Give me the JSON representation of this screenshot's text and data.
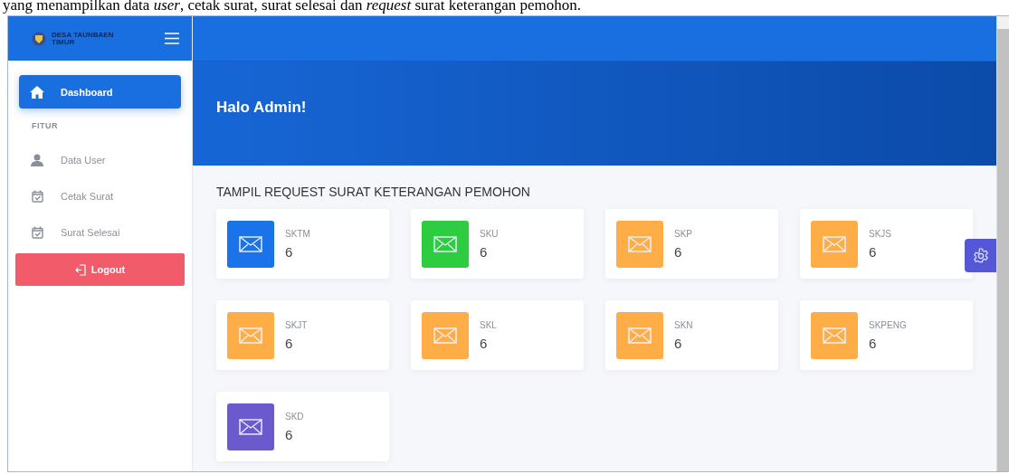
{
  "caption": "yang menampilkan data *user*, cetak surat, surat selesai dan *request* surat keterangan pemohon.",
  "brand": {
    "name": "DESA TAUNBAEN TIMUR"
  },
  "sidebar": {
    "items": [
      {
        "kind": "link",
        "label": "Dashboard",
        "selected": true
      },
      {
        "kind": "heading",
        "label": "FITUR"
      },
      {
        "kind": "link",
        "label": "Data User",
        "selected": false
      },
      {
        "kind": "link",
        "label": "Cetak Surat",
        "selected": false
      },
      {
        "kind": "link",
        "label": "Surat Selesai",
        "selected": false
      }
    ],
    "logout": "Logout"
  },
  "hero": {
    "greeting": "Halo Admin!"
  },
  "section_title": "TAMPIL REQUEST SURAT KETERANGAN PEMOHON",
  "cards": [
    {
      "label": "SKTM",
      "count": "6",
      "color": "#1a73e8"
    },
    {
      "label": "SKU",
      "count": "6",
      "color": "#2ecc40"
    },
    {
      "label": "SKP",
      "count": "6",
      "color": "#ffad46"
    },
    {
      "label": "SKJS",
      "count": "6",
      "color": "#ffad46"
    },
    {
      "label": "SKJT",
      "count": "6",
      "color": "#ffad46"
    },
    {
      "label": "SKL",
      "count": "6",
      "color": "#ffad46"
    },
    {
      "label": "SKN",
      "count": "6",
      "color": "#ffad46"
    },
    {
      "label": "SKPENG",
      "count": "6",
      "color": "#ffad46"
    },
    {
      "label": "SKD",
      "count": "6",
      "color": "#6a5acd"
    }
  ]
}
